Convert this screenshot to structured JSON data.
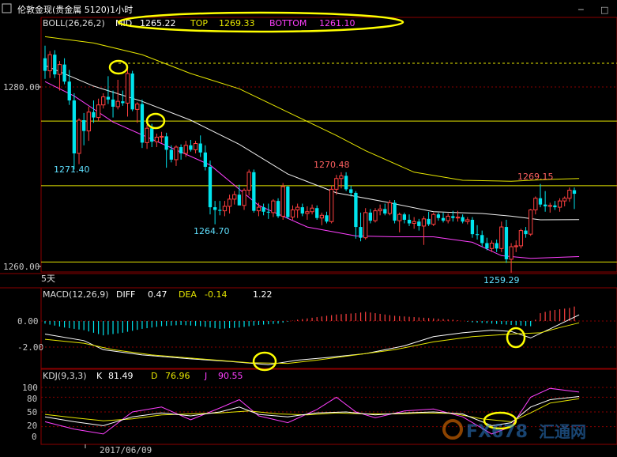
{
  "window": {
    "title": "伦敦金现(贵金属 5120)1小时",
    "minimize_glyph": "─",
    "restore_glyph": "□"
  },
  "boll_header": {
    "label": "BOLL(26,26,2)",
    "mid_label": "MID",
    "mid_value": "1265.22",
    "top_label": "TOP",
    "top_value": "1269.33",
    "bottom_label": "BOTTOM",
    "bottom_value": "1261.10"
  },
  "macd_header": {
    "label": "MACD(12,26,9)",
    "diff_label": "DIFF",
    "diff_value": "0.47",
    "dea_label": "DEA",
    "dea_value": "-0.14",
    "macd_value": "1.22"
  },
  "kdj_header": {
    "label": "KDJ(9,3,3)",
    "k_label": "K",
    "k_value": "81.49",
    "d_label": "D",
    "d_value": "76.96",
    "j_label": "J",
    "j_value": "90.55"
  },
  "price_axis": {
    "ticks": [
      "1280.00",
      "1260.00"
    ]
  },
  "macd_axis": {
    "ticks": [
      "0.00",
      "-2.00"
    ]
  },
  "kdj_axis": {
    "ticks": [
      "100",
      "80",
      "50",
      "20",
      "0"
    ]
  },
  "time_axis": {
    "date_label": "2017/06/09",
    "period_label": "5天"
  },
  "annotations": {
    "high_1": "1271.40",
    "low_1": "1264.70",
    "high_2": "1270.48",
    "high_3": "1269.15",
    "low_2": "1259.29"
  },
  "watermark": {
    "brand": "FX678",
    "cn": "汇通网"
  },
  "colors": {
    "bull": "#ff4040",
    "bear": "#00e5ee",
    "boll_top": "#e6e600",
    "boll_mid": "#f0f0f0",
    "boll_bottom": "#ff40ff",
    "grid": "#8b0000",
    "highlight": "#ffff00"
  },
  "chart_data": {
    "type": "candlestick",
    "symbol": "伦敦金现",
    "interval": "1小时",
    "price_ylim": [
      1258.5,
      1285.8
    ],
    "horizontal_levels": [
      1276.2,
      1269.0,
      1260.5
    ],
    "ohlc": [
      [
        1283.2,
        1284.6,
        1280.9,
        1281.8
      ],
      [
        1281.8,
        1284.0,
        1281.0,
        1283.6
      ],
      [
        1283.6,
        1284.1,
        1281.0,
        1281.4
      ],
      [
        1281.4,
        1282.9,
        1279.6,
        1282.5
      ],
      [
        1282.5,
        1283.2,
        1280.3,
        1280.6
      ],
      [
        1280.6,
        1281.9,
        1278.0,
        1278.5
      ],
      [
        1278.5,
        1279.3,
        1270.8,
        1272.6
      ],
      [
        1272.6,
        1276.5,
        1271.4,
        1276.3
      ],
      [
        1276.3,
        1277.1,
        1273.5,
        1275.1
      ],
      [
        1275.1,
        1277.8,
        1274.0,
        1277.2
      ],
      [
        1277.2,
        1278.5,
        1276.0,
        1276.6
      ],
      [
        1276.6,
        1278.7,
        1276.2,
        1278.0
      ],
      [
        1278.0,
        1279.3,
        1277.6,
        1278.9
      ],
      [
        1278.9,
        1281.2,
        1278.1,
        1278.6
      ],
      [
        1278.6,
        1279.6,
        1276.6,
        1277.8
      ],
      [
        1277.8,
        1280.8,
        1277.5,
        1278.4
      ],
      [
        1278.4,
        1279.6,
        1277.9,
        1278.2
      ],
      [
        1278.2,
        1282.0,
        1276.7,
        1281.5
      ],
      [
        1281.5,
        1281.8,
        1277.3,
        1277.5
      ],
      [
        1277.5,
        1278.3,
        1276.0,
        1278.1
      ],
      [
        1278.1,
        1278.6,
        1273.2,
        1273.8
      ],
      [
        1273.8,
        1275.8,
        1273.1,
        1275.4
      ],
      [
        1275.4,
        1275.9,
        1273.3,
        1273.9
      ],
      [
        1273.9,
        1274.8,
        1273.3,
        1274.4
      ],
      [
        1274.4,
        1275.0,
        1273.8,
        1274.5
      ],
      [
        1274.5,
        1274.9,
        1271.0,
        1273.0
      ],
      [
        1273.0,
        1273.5,
        1271.6,
        1271.9
      ],
      [
        1271.9,
        1273.5,
        1271.2,
        1273.3
      ],
      [
        1273.3,
        1273.6,
        1271.9,
        1272.6
      ],
      [
        1272.6,
        1274.0,
        1272.2,
        1273.5
      ],
      [
        1273.5,
        1274.1,
        1272.8,
        1273.0
      ],
      [
        1273.0,
        1274.0,
        1272.6,
        1273.7
      ],
      [
        1273.7,
        1274.6,
        1272.2,
        1272.7
      ],
      [
        1272.7,
        1273.5,
        1270.7,
        1271.1
      ],
      [
        1271.1,
        1271.8,
        1265.8,
        1266.6
      ],
      [
        1266.6,
        1267.3,
        1264.7,
        1266.3
      ],
      [
        1266.3,
        1267.3,
        1265.7,
        1266.2
      ],
      [
        1266.2,
        1267.3,
        1265.6,
        1266.7
      ],
      [
        1266.7,
        1268.0,
        1265.9,
        1267.5
      ],
      [
        1267.5,
        1268.4,
        1266.9,
        1268.0
      ],
      [
        1268.0,
        1269.1,
        1267.5,
        1266.8
      ],
      [
        1266.8,
        1268.7,
        1266.3,
        1268.5
      ],
      [
        1268.5,
        1270.8,
        1267.9,
        1270.5
      ],
      [
        1270.5,
        1270.8,
        1266.0,
        1266.2
      ],
      [
        1266.2,
        1267.1,
        1265.6,
        1266.6
      ],
      [
        1266.6,
        1267.0,
        1265.7,
        1266.1
      ],
      [
        1266.1,
        1267.0,
        1265.3,
        1266.0
      ],
      [
        1266.0,
        1267.5,
        1265.5,
        1267.3
      ],
      [
        1267.3,
        1267.6,
        1265.4,
        1265.6
      ],
      [
        1265.6,
        1269.3,
        1265.2,
        1268.9
      ],
      [
        1268.9,
        1269.0,
        1265.3,
        1265.5
      ],
      [
        1265.5,
        1266.8,
        1265.2,
        1266.3
      ],
      [
        1266.3,
        1267.0,
        1265.4,
        1266.6
      ],
      [
        1266.6,
        1267.0,
        1265.6,
        1265.9
      ],
      [
        1265.9,
        1266.7,
        1265.2,
        1266.1
      ],
      [
        1266.1,
        1266.9,
        1265.8,
        1266.5
      ],
      [
        1266.5,
        1266.8,
        1265.2,
        1265.4
      ],
      [
        1265.4,
        1266.0,
        1264.6,
        1265.7
      ],
      [
        1265.7,
        1266.1,
        1264.8,
        1265.0
      ],
      [
        1265.0,
        1269.0,
        1264.8,
        1268.6
      ],
      [
        1268.6,
        1270.2,
        1268.0,
        1269.8
      ],
      [
        1269.8,
        1270.5,
        1268.7,
        1270.1
      ],
      [
        1270.1,
        1270.5,
        1268.4,
        1268.6
      ],
      [
        1268.6,
        1269.0,
        1267.8,
        1268.2
      ],
      [
        1268.2,
        1268.4,
        1263.1,
        1264.4
      ],
      [
        1264.4,
        1266.0,
        1262.8,
        1263.2
      ],
      [
        1263.2,
        1266.5,
        1263.0,
        1266.0
      ],
      [
        1266.0,
        1266.4,
        1264.8,
        1265.1
      ],
      [
        1265.1,
        1266.5,
        1264.9,
        1266.2
      ],
      [
        1266.2,
        1266.9,
        1265.7,
        1266.4
      ],
      [
        1266.4,
        1267.0,
        1265.7,
        1265.9
      ],
      [
        1265.9,
        1267.4,
        1265.7,
        1267.1
      ],
      [
        1267.1,
        1267.4,
        1264.8,
        1265.1
      ],
      [
        1265.1,
        1266.0,
        1263.8,
        1265.8
      ],
      [
        1265.8,
        1266.0,
        1264.8,
        1265.2
      ],
      [
        1265.2,
        1265.8,
        1264.5,
        1264.8
      ],
      [
        1264.8,
        1265.5,
        1264.2,
        1265.0
      ],
      [
        1265.0,
        1265.3,
        1264.0,
        1264.5
      ],
      [
        1264.5,
        1265.6,
        1262.4,
        1265.3
      ],
      [
        1265.3,
        1266.1,
        1264.5,
        1264.7
      ],
      [
        1264.7,
        1266.0,
        1264.5,
        1265.8
      ],
      [
        1265.8,
        1266.0,
        1265.1,
        1265.4
      ],
      [
        1265.4,
        1266.0,
        1264.9,
        1265.1
      ],
      [
        1265.1,
        1265.9,
        1264.8,
        1265.6
      ],
      [
        1265.6,
        1266.2,
        1265.0,
        1265.4
      ],
      [
        1265.4,
        1266.2,
        1265.0,
        1265.5
      ],
      [
        1265.5,
        1265.8,
        1264.8,
        1265.0
      ],
      [
        1265.0,
        1265.5,
        1264.7,
        1265.2
      ],
      [
        1265.2,
        1265.5,
        1263.2,
        1263.6
      ],
      [
        1263.6,
        1264.6,
        1263.0,
        1263.5
      ],
      [
        1263.5,
        1264.0,
        1262.2,
        1262.6
      ],
      [
        1262.6,
        1263.2,
        1261.8,
        1262.0
      ],
      [
        1262.0,
        1262.9,
        1261.6,
        1262.6
      ],
      [
        1262.6,
        1263.0,
        1261.6,
        1262.0
      ],
      [
        1262.0,
        1265.0,
        1261.6,
        1264.4
      ],
      [
        1264.4,
        1265.2,
        1260.4,
        1260.8
      ],
      [
        1260.8,
        1262.6,
        1259.3,
        1262.2
      ],
      [
        1262.2,
        1262.9,
        1261.6,
        1262.3
      ],
      [
        1262.3,
        1264.2,
        1262.0,
        1264.0
      ],
      [
        1264.0,
        1264.4,
        1263.2,
        1263.6
      ],
      [
        1263.6,
        1266.4,
        1263.4,
        1266.3
      ],
      [
        1266.3,
        1267.8,
        1265.8,
        1267.6
      ],
      [
        1267.6,
        1269.2,
        1266.6,
        1266.9
      ],
      [
        1266.9,
        1268.4,
        1266.1,
        1266.7
      ],
      [
        1266.7,
        1267.1,
        1266.0,
        1266.8
      ],
      [
        1266.8,
        1267.3,
        1266.3,
        1266.6
      ],
      [
        1266.6,
        1267.6,
        1266.1,
        1267.3
      ],
      [
        1267.3,
        1267.8,
        1266.7,
        1267.6
      ],
      [
        1267.6,
        1268.8,
        1267.2,
        1268.5
      ],
      [
        1268.5,
        1268.8,
        1266.4,
        1268.1
      ]
    ],
    "boll_top": [
      [
        0,
        1285.6
      ],
      [
        10,
        1284.9
      ],
      [
        20,
        1283.6
      ],
      [
        30,
        1281.5
      ],
      [
        40,
        1279.8
      ],
      [
        50,
        1277.2
      ],
      [
        60,
        1274.6
      ],
      [
        66,
        1272.9
      ],
      [
        76,
        1270.5
      ],
      [
        86,
        1269.6
      ],
      [
        96,
        1269.5
      ],
      [
        104,
        1269.7
      ],
      [
        110,
        1269.8
      ]
    ],
    "boll_mid": [
      [
        0,
        1282.4
      ],
      [
        10,
        1280.1
      ],
      [
        20,
        1278.4
      ],
      [
        30,
        1276.3
      ],
      [
        40,
        1273.6
      ],
      [
        50,
        1270.3
      ],
      [
        60,
        1268.2
      ],
      [
        70,
        1267.2
      ],
      [
        80,
        1266.1
      ],
      [
        90,
        1265.9
      ],
      [
        96,
        1265.6
      ],
      [
        102,
        1265.2
      ],
      [
        110,
        1265.22
      ]
    ],
    "boll_bottom": [
      [
        0,
        1280.6
      ],
      [
        6,
        1279.0
      ],
      [
        14,
        1276.1
      ],
      [
        24,
        1273.7
      ],
      [
        34,
        1271.3
      ],
      [
        44,
        1266.8
      ],
      [
        54,
        1264.4
      ],
      [
        64,
        1263.4
      ],
      [
        72,
        1263.3
      ],
      [
        80,
        1263.3
      ],
      [
        88,
        1262.7
      ],
      [
        94,
        1261.2
      ],
      [
        100,
        1260.9
      ],
      [
        110,
        1261.1
      ]
    ],
    "macd": {
      "ylim": [
        -3.8,
        1.5
      ],
      "diff": [
        [
          0,
          -1.0
        ],
        [
          8,
          -1.5
        ],
        [
          12,
          -2.2
        ],
        [
          20,
          -2.6
        ],
        [
          30,
          -2.9
        ],
        [
          38,
          -3.1
        ],
        [
          46,
          -3.35
        ],
        [
          52,
          -3.0
        ],
        [
          58,
          -2.8
        ],
        [
          66,
          -2.5
        ],
        [
          74,
          -1.9
        ],
        [
          80,
          -1.2
        ],
        [
          86,
          -0.9
        ],
        [
          92,
          -0.7
        ],
        [
          96,
          -0.8
        ],
        [
          100,
          -1.3
        ],
        [
          104,
          -0.6
        ],
        [
          110,
          0.47
        ]
      ],
      "dea": [
        [
          0,
          -1.4
        ],
        [
          8,
          -1.7
        ],
        [
          14,
          -2.2
        ],
        [
          22,
          -2.6
        ],
        [
          32,
          -2.9
        ],
        [
          42,
          -3.2
        ],
        [
          50,
          -3.25
        ],
        [
          56,
          -3.0
        ],
        [
          64,
          -2.6
        ],
        [
          72,
          -2.2
        ],
        [
          80,
          -1.6
        ],
        [
          88,
          -1.2
        ],
        [
          96,
          -1.0
        ],
        [
          102,
          -0.9
        ],
        [
          106,
          -0.5
        ],
        [
          110,
          -0.14
        ]
      ],
      "hist_sample": [
        [
          0,
          -0.2
        ],
        [
          4,
          -0.5
        ],
        [
          8,
          -0.7
        ],
        [
          12,
          -1.1
        ],
        [
          16,
          -0.9
        ],
        [
          20,
          -0.6
        ],
        [
          24,
          -0.4
        ],
        [
          28,
          -0.3
        ],
        [
          32,
          -0.4
        ],
        [
          36,
          -0.6
        ],
        [
          40,
          -0.5
        ],
        [
          44,
          -0.3
        ],
        [
          48,
          -0.2
        ],
        [
          52,
          0.1
        ],
        [
          56,
          0.3
        ],
        [
          60,
          0.5
        ],
        [
          64,
          0.6
        ],
        [
          66,
          0.7
        ],
        [
          68,
          0.6
        ],
        [
          72,
          0.4
        ],
        [
          76,
          0.3
        ],
        [
          80,
          0.2
        ],
        [
          84,
          0.1
        ],
        [
          88,
          -0.1
        ],
        [
          92,
          -0.2
        ],
        [
          96,
          -0.3
        ],
        [
          100,
          -0.4
        ],
        [
          102,
          0.6
        ],
        [
          104,
          0.8
        ],
        [
          106,
          0.9
        ],
        [
          108,
          1.0
        ],
        [
          110,
          1.22
        ]
      ]
    },
    "kdj": {
      "ylim": [
        0,
        100
      ],
      "k": [
        [
          0,
          40
        ],
        [
          6,
          30
        ],
        [
          12,
          22
        ],
        [
          18,
          40
        ],
        [
          24,
          48
        ],
        [
          30,
          42
        ],
        [
          36,
          50
        ],
        [
          40,
          60
        ],
        [
          44,
          45
        ],
        [
          50,
          40
        ],
        [
          56,
          48
        ],
        [
          62,
          50
        ],
        [
          68,
          44
        ],
        [
          74,
          48
        ],
        [
          80,
          50
        ],
        [
          86,
          46
        ],
        [
          92,
          22
        ],
        [
          96,
          28
        ],
        [
          100,
          60
        ],
        [
          104,
          75
        ],
        [
          110,
          81.49
        ]
      ],
      "d": [
        [
          0,
          45
        ],
        [
          6,
          38
        ],
        [
          12,
          32
        ],
        [
          18,
          36
        ],
        [
          24,
          44
        ],
        [
          30,
          46
        ],
        [
          36,
          48
        ],
        [
          42,
          52
        ],
        [
          48,
          46
        ],
        [
          54,
          44
        ],
        [
          60,
          48
        ],
        [
          66,
          46
        ],
        [
          72,
          46
        ],
        [
          78,
          48
        ],
        [
          84,
          47
        ],
        [
          90,
          36
        ],
        [
          96,
          30
        ],
        [
          100,
          48
        ],
        [
          104,
          68
        ],
        [
          110,
          76.96
        ]
      ],
      "j": [
        [
          0,
          30
        ],
        [
          6,
          15
        ],
        [
          12,
          5
        ],
        [
          18,
          50
        ],
        [
          24,
          60
        ],
        [
          30,
          34
        ],
        [
          36,
          58
        ],
        [
          40,
          75
        ],
        [
          44,
          42
        ],
        [
          50,
          28
        ],
        [
          56,
          55
        ],
        [
          60,
          80
        ],
        [
          64,
          50
        ],
        [
          68,
          38
        ],
        [
          74,
          52
        ],
        [
          80,
          56
        ],
        [
          86,
          40
        ],
        [
          92,
          5
        ],
        [
          96,
          20
        ],
        [
          100,
          80
        ],
        [
          104,
          98
        ],
        [
          110,
          90.55
        ]
      ]
    }
  }
}
